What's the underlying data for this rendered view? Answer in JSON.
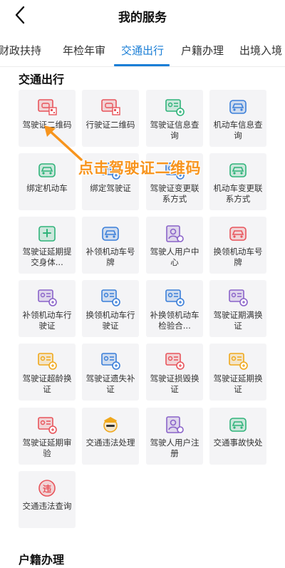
{
  "header": {
    "title": "我的服务",
    "back_icon": "chevron-left-icon"
  },
  "tabs": [
    {
      "label": "财政扶持",
      "active": false
    },
    {
      "label": "年检年审",
      "active": false
    },
    {
      "label": "交通出行",
      "active": true
    },
    {
      "label": "户籍办理",
      "active": false
    },
    {
      "label": "出境入境",
      "active": false
    }
  ],
  "colors": {
    "accent": "#1a7ed6",
    "annotation": "#f7941d"
  },
  "sections": [
    {
      "title": "交通出行",
      "items": [
        {
          "label": "驾驶证二维码",
          "icon": "driver-license-qr-icon",
          "color": "#e8545b"
        },
        {
          "label": "行驶证二维码",
          "icon": "vehicle-license-qr-icon",
          "color": "#e8545b"
        },
        {
          "label": "驾驶证信息查询",
          "icon": "license-info-icon",
          "color": "#2fb37a"
        },
        {
          "label": "机动车信息查询",
          "icon": "car-search-icon",
          "color": "#3b7fd9"
        },
        {
          "label": "绑定机动车",
          "icon": "bind-car-icon",
          "color": "#2fb37a"
        },
        {
          "label": "绑定驾驶证",
          "icon": "bind-license-icon",
          "color": "#3b7fd9"
        },
        {
          "label": "驾驶证变更联系方式",
          "icon": "license-contact-icon",
          "color": "#3b7fd9"
        },
        {
          "label": "机动车变更联系方式",
          "icon": "car-contact-icon",
          "color": "#2fb37a"
        },
        {
          "label": "驾驶证延期提交身体...",
          "icon": "medical-icon",
          "color": "#2fb37a"
        },
        {
          "label": "补领机动车号牌",
          "icon": "plate-reissue-icon",
          "color": "#3b7fd9"
        },
        {
          "label": "驾驶人用户中心",
          "icon": "driver-user-center-icon",
          "color": "#8a63c9"
        },
        {
          "label": "换领机动车号牌",
          "icon": "plate-exchange-icon",
          "color": "#e8545b"
        },
        {
          "label": "补领机动车行驶证",
          "icon": "vehicle-license-reissue-icon",
          "color": "#8a63c9"
        },
        {
          "label": "换领机动车行驶证",
          "icon": "vehicle-license-exchange-icon",
          "color": "#3b7fd9"
        },
        {
          "label": "补换领机动车检验合...",
          "icon": "inspection-cert-icon",
          "color": "#3b7fd9"
        },
        {
          "label": "驾驶证期满换证",
          "icon": "license-expire-icon",
          "color": "#8a63c9"
        },
        {
          "label": "驾驶证超龄换证",
          "icon": "license-overage-icon",
          "color": "#f0a81c"
        },
        {
          "label": "驾驶证遗失补证",
          "icon": "license-lost-icon",
          "color": "#3b7fd9"
        },
        {
          "label": "驾驶证损毁换证",
          "icon": "license-damaged-icon",
          "color": "#e8545b"
        },
        {
          "label": "驾驶证延期换证",
          "icon": "license-extend-icon",
          "color": "#f0a81c"
        },
        {
          "label": "驾驶证延期审验",
          "icon": "license-review-icon",
          "color": "#e8545b"
        },
        {
          "label": "交通违法处理",
          "icon": "police-officer-icon",
          "color": "#f0a81c"
        },
        {
          "label": "驾驶人用户注册",
          "icon": "driver-register-icon",
          "color": "#8a63c9"
        },
        {
          "label": "交通事故快处",
          "icon": "accident-icon",
          "color": "#2fb37a"
        },
        {
          "label": "交通违法查询",
          "icon": "violation-query-icon",
          "color": "#e8545b"
        }
      ]
    },
    {
      "title": "户籍办理",
      "items": []
    }
  ],
  "annotation": {
    "text": "点击驾驶证二维码"
  }
}
